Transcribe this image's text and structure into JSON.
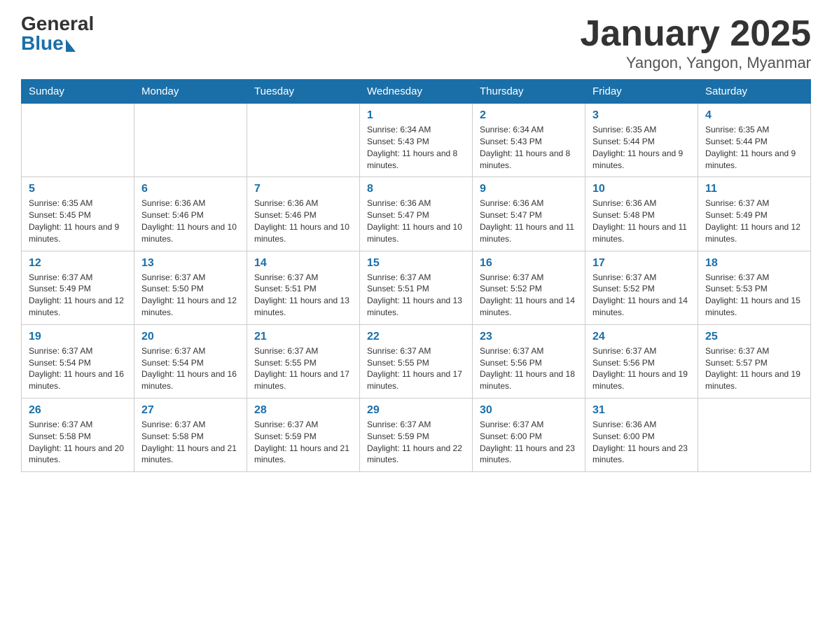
{
  "header": {
    "logo_general": "General",
    "logo_blue": "Blue",
    "month_title": "January 2025",
    "location": "Yangon, Yangon, Myanmar"
  },
  "days_of_week": [
    "Sunday",
    "Monday",
    "Tuesday",
    "Wednesday",
    "Thursday",
    "Friday",
    "Saturday"
  ],
  "weeks": [
    {
      "days": [
        {
          "num": "",
          "info": ""
        },
        {
          "num": "",
          "info": ""
        },
        {
          "num": "",
          "info": ""
        },
        {
          "num": "1",
          "info": "Sunrise: 6:34 AM\nSunset: 5:43 PM\nDaylight: 11 hours and 8 minutes."
        },
        {
          "num": "2",
          "info": "Sunrise: 6:34 AM\nSunset: 5:43 PM\nDaylight: 11 hours and 8 minutes."
        },
        {
          "num": "3",
          "info": "Sunrise: 6:35 AM\nSunset: 5:44 PM\nDaylight: 11 hours and 9 minutes."
        },
        {
          "num": "4",
          "info": "Sunrise: 6:35 AM\nSunset: 5:44 PM\nDaylight: 11 hours and 9 minutes."
        }
      ]
    },
    {
      "days": [
        {
          "num": "5",
          "info": "Sunrise: 6:35 AM\nSunset: 5:45 PM\nDaylight: 11 hours and 9 minutes."
        },
        {
          "num": "6",
          "info": "Sunrise: 6:36 AM\nSunset: 5:46 PM\nDaylight: 11 hours and 10 minutes."
        },
        {
          "num": "7",
          "info": "Sunrise: 6:36 AM\nSunset: 5:46 PM\nDaylight: 11 hours and 10 minutes."
        },
        {
          "num": "8",
          "info": "Sunrise: 6:36 AM\nSunset: 5:47 PM\nDaylight: 11 hours and 10 minutes."
        },
        {
          "num": "9",
          "info": "Sunrise: 6:36 AM\nSunset: 5:47 PM\nDaylight: 11 hours and 11 minutes."
        },
        {
          "num": "10",
          "info": "Sunrise: 6:36 AM\nSunset: 5:48 PM\nDaylight: 11 hours and 11 minutes."
        },
        {
          "num": "11",
          "info": "Sunrise: 6:37 AM\nSunset: 5:49 PM\nDaylight: 11 hours and 12 minutes."
        }
      ]
    },
    {
      "days": [
        {
          "num": "12",
          "info": "Sunrise: 6:37 AM\nSunset: 5:49 PM\nDaylight: 11 hours and 12 minutes."
        },
        {
          "num": "13",
          "info": "Sunrise: 6:37 AM\nSunset: 5:50 PM\nDaylight: 11 hours and 12 minutes."
        },
        {
          "num": "14",
          "info": "Sunrise: 6:37 AM\nSunset: 5:51 PM\nDaylight: 11 hours and 13 minutes."
        },
        {
          "num": "15",
          "info": "Sunrise: 6:37 AM\nSunset: 5:51 PM\nDaylight: 11 hours and 13 minutes."
        },
        {
          "num": "16",
          "info": "Sunrise: 6:37 AM\nSunset: 5:52 PM\nDaylight: 11 hours and 14 minutes."
        },
        {
          "num": "17",
          "info": "Sunrise: 6:37 AM\nSunset: 5:52 PM\nDaylight: 11 hours and 14 minutes."
        },
        {
          "num": "18",
          "info": "Sunrise: 6:37 AM\nSunset: 5:53 PM\nDaylight: 11 hours and 15 minutes."
        }
      ]
    },
    {
      "days": [
        {
          "num": "19",
          "info": "Sunrise: 6:37 AM\nSunset: 5:54 PM\nDaylight: 11 hours and 16 minutes."
        },
        {
          "num": "20",
          "info": "Sunrise: 6:37 AM\nSunset: 5:54 PM\nDaylight: 11 hours and 16 minutes."
        },
        {
          "num": "21",
          "info": "Sunrise: 6:37 AM\nSunset: 5:55 PM\nDaylight: 11 hours and 17 minutes."
        },
        {
          "num": "22",
          "info": "Sunrise: 6:37 AM\nSunset: 5:55 PM\nDaylight: 11 hours and 17 minutes."
        },
        {
          "num": "23",
          "info": "Sunrise: 6:37 AM\nSunset: 5:56 PM\nDaylight: 11 hours and 18 minutes."
        },
        {
          "num": "24",
          "info": "Sunrise: 6:37 AM\nSunset: 5:56 PM\nDaylight: 11 hours and 19 minutes."
        },
        {
          "num": "25",
          "info": "Sunrise: 6:37 AM\nSunset: 5:57 PM\nDaylight: 11 hours and 19 minutes."
        }
      ]
    },
    {
      "days": [
        {
          "num": "26",
          "info": "Sunrise: 6:37 AM\nSunset: 5:58 PM\nDaylight: 11 hours and 20 minutes."
        },
        {
          "num": "27",
          "info": "Sunrise: 6:37 AM\nSunset: 5:58 PM\nDaylight: 11 hours and 21 minutes."
        },
        {
          "num": "28",
          "info": "Sunrise: 6:37 AM\nSunset: 5:59 PM\nDaylight: 11 hours and 21 minutes."
        },
        {
          "num": "29",
          "info": "Sunrise: 6:37 AM\nSunset: 5:59 PM\nDaylight: 11 hours and 22 minutes."
        },
        {
          "num": "30",
          "info": "Sunrise: 6:37 AM\nSunset: 6:00 PM\nDaylight: 11 hours and 23 minutes."
        },
        {
          "num": "31",
          "info": "Sunrise: 6:36 AM\nSunset: 6:00 PM\nDaylight: 11 hours and 23 minutes."
        },
        {
          "num": "",
          "info": ""
        }
      ]
    }
  ]
}
